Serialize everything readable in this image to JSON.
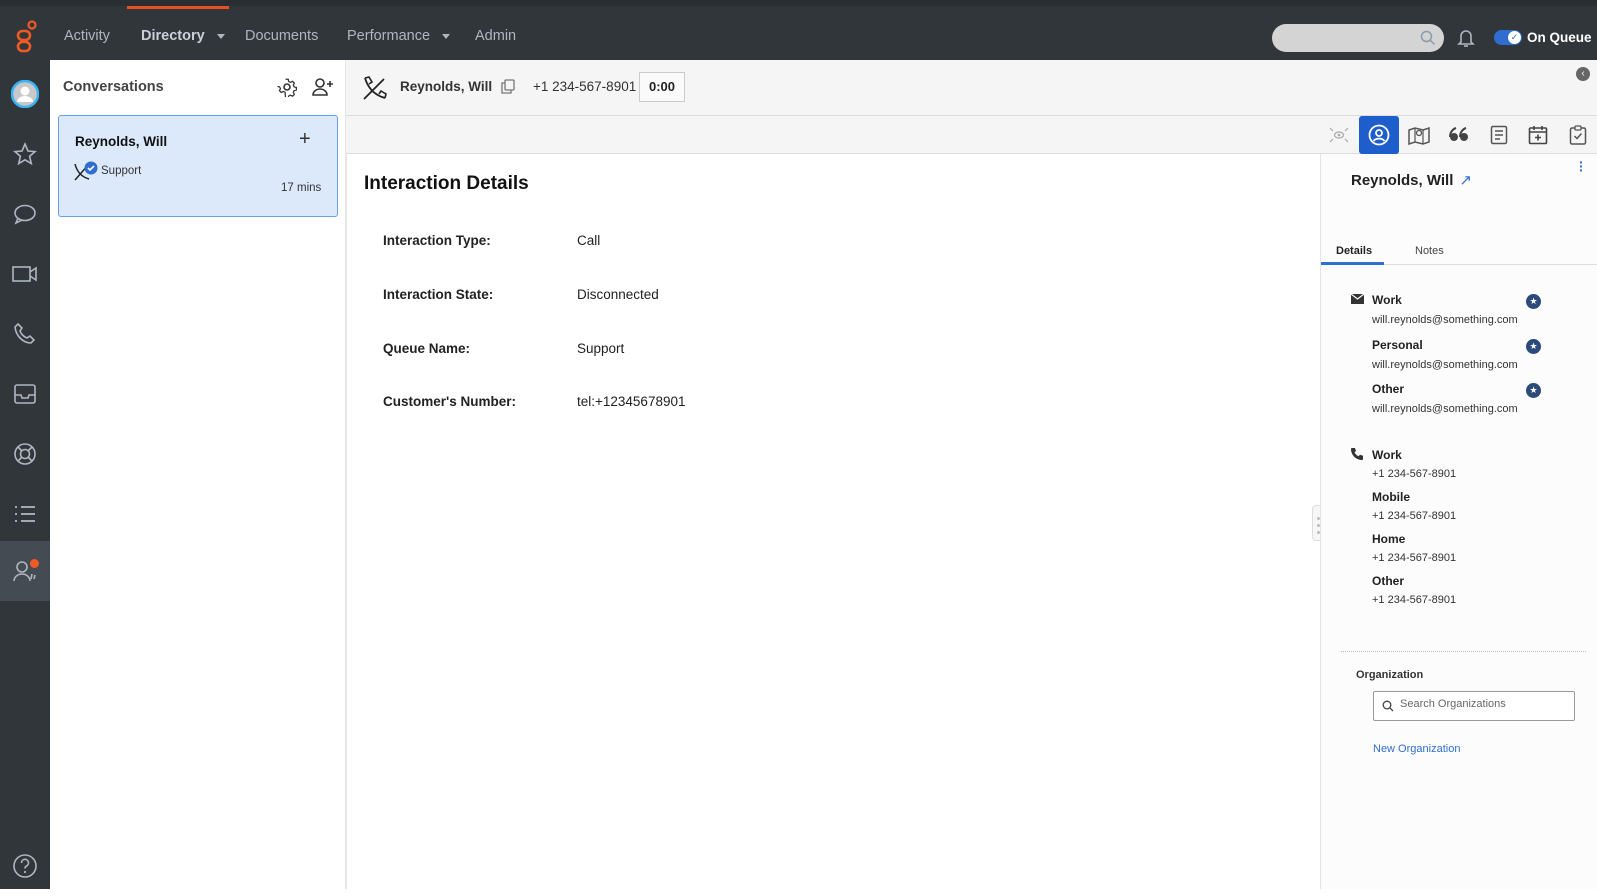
{
  "topnav": {
    "items": [
      {
        "label": "Activity"
      },
      {
        "label": "Directory",
        "active": true,
        "dropdown": true
      },
      {
        "label": "Documents"
      },
      {
        "label": "Performance",
        "dropdown": true
      },
      {
        "label": "Admin"
      }
    ],
    "search_placeholder": "",
    "status_label": "On Queue",
    "accent_color": "#e8501f"
  },
  "rail": {
    "icons": [
      "avatar-icon",
      "star-icon",
      "chat-icon",
      "video-icon",
      "phone-icon",
      "inbox-icon",
      "lifebuoy-icon",
      "list-icon",
      "people-icon",
      "help-icon"
    ]
  },
  "conversations": {
    "title": "Conversations",
    "card": {
      "name": "Reynolds, Will",
      "queue": "Support",
      "time": "17 mins"
    }
  },
  "callbar": {
    "name": "Reynolds, Will",
    "number": "+1 234-567-8901",
    "timer": "0:00"
  },
  "toolbar": {
    "icons": [
      "monitor-icon",
      "contact-icon",
      "journey-map-icon",
      "quote-icon",
      "script-icon",
      "schedule-icon",
      "wrapup-icon"
    ],
    "selected": "contact-icon"
  },
  "interaction": {
    "title": "Interaction Details",
    "rows": [
      {
        "label": "Interaction Type:",
        "value": "Call"
      },
      {
        "label": "Interaction State:",
        "value": "Disconnected"
      },
      {
        "label": "Queue Name:",
        "value": "Support"
      },
      {
        "label": "Customer's Number:",
        "value": "tel:+12345678901"
      }
    ]
  },
  "contact": {
    "name": "Reynolds, Will",
    "tabs": [
      {
        "label": "Details"
      },
      {
        "label": "Notes"
      }
    ],
    "active_tab": "Details",
    "emails": [
      {
        "label": "Work",
        "value": "will.reynolds@something.com"
      },
      {
        "label": "Personal",
        "value": "will.reynolds@something.com"
      },
      {
        "label": "Other",
        "value": "will.reynolds@something.com"
      }
    ],
    "phones": [
      {
        "label": "Work",
        "value": "+1 234-567-8901"
      },
      {
        "label": "Mobile",
        "value": "+1 234-567-8901"
      },
      {
        "label": "Home",
        "value": "+1 234-567-8901"
      },
      {
        "label": "Other",
        "value": "+1 234-567-8901"
      }
    ],
    "organization": {
      "label": "Organization",
      "search_placeholder": "Search Organizations",
      "new_link": "New Organization"
    }
  }
}
